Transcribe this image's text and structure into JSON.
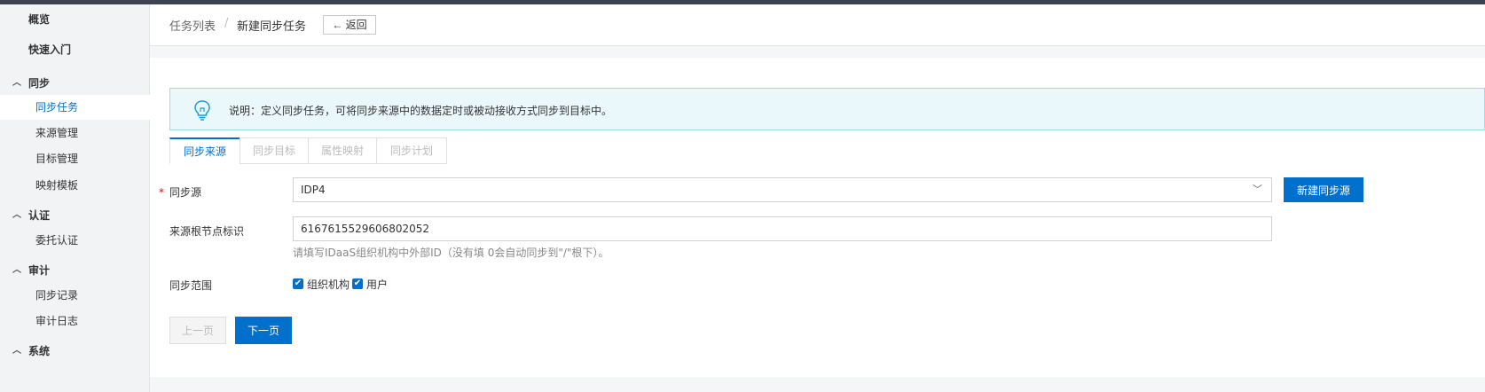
{
  "sidebar": {
    "overview": "概览",
    "quickstart": "快速入门",
    "groups": [
      {
        "label": "同步",
        "items": [
          "同步任务",
          "来源管理",
          "目标管理",
          "映射模板"
        ]
      },
      {
        "label": "认证",
        "items": [
          "委托认证"
        ]
      },
      {
        "label": "审计",
        "items": [
          "同步记录",
          "审计日志"
        ]
      },
      {
        "label": "系统",
        "items": []
      }
    ],
    "active_item": "同步任务"
  },
  "header": {
    "breadcrumb_parent": "任务列表",
    "breadcrumb_sep": "/",
    "breadcrumb_current": "新建同步任务",
    "back_label": "返回"
  },
  "notice": {
    "text": "说明：定义同步任务，可将同步来源中的数据定时或被动接收方式同步到目标中。"
  },
  "tabs": [
    "同步来源",
    "同步目标",
    "属性映射",
    "同步计划"
  ],
  "form": {
    "source_label": "同步源",
    "source_required_mark": "*",
    "source_value": "IDP4",
    "new_source_button": "新建同步源",
    "root_label": "来源根节点标识",
    "root_value": "6167615529606802052",
    "root_hint": "请填写IDaaS组织机构中外部ID（没有填 0会自动同步到\"/\"根下）。",
    "scope_label": "同步范围",
    "scope_org": "组织机构",
    "scope_user": "用户",
    "scope_org_checked": true,
    "scope_user_checked": true
  },
  "buttons": {
    "prev": "上一页",
    "next": "下一页"
  },
  "colors": {
    "accent": "#0070cc",
    "notice_bg": "#eaf7fb",
    "notice_border": "#9fd9ea"
  }
}
